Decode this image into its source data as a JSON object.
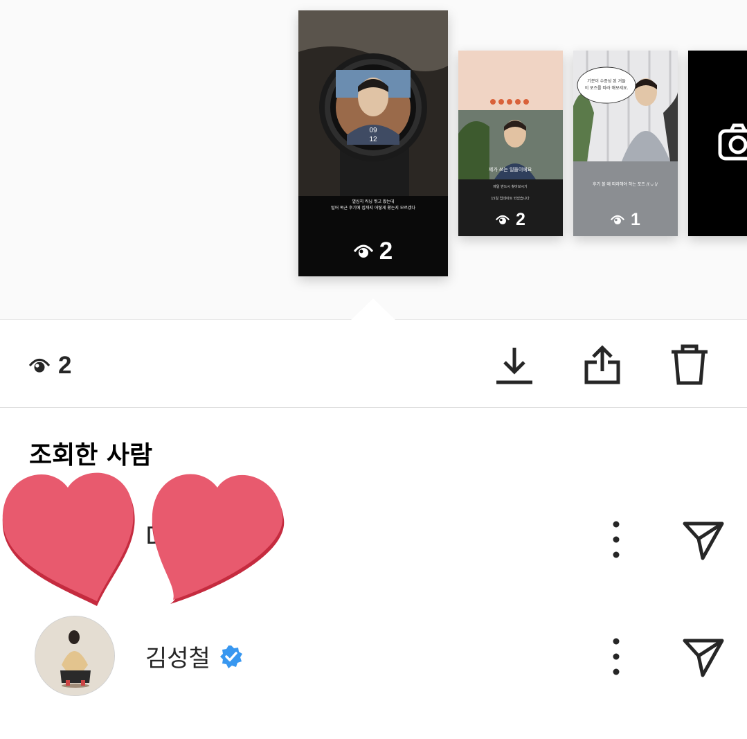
{
  "stories": [
    {
      "id": "story-1",
      "caption_line1": "열심히 러닝 뛰고 왔는데",
      "caption_line2": "털어 목근 후기에 집까지 어떻게 왔는지 모르겠다",
      "views": "2"
    },
    {
      "id": "story-2",
      "caption_line1": "제가 쓰는 일들이에요",
      "caption_line2": "15일 업데이트 되었습니다",
      "views": "2"
    },
    {
      "id": "story-3",
      "bubble": "기분이 수증성 된 거들 지면서 이 포즈를 따라 해보세요.",
      "caption": "후기 볼 때 따라해야 하는 포즈 /(·ᴗ·)/",
      "views": "1"
    }
  ],
  "selected_view_count": "2",
  "actions": {
    "download": "download",
    "share": "share",
    "delete": "delete"
  },
  "viewers_title": "조회한 사람",
  "viewers": [
    {
      "name": "D",
      "verified": false
    },
    {
      "name": "김성철",
      "verified": true
    }
  ],
  "icons": {
    "eye": "eye-icon",
    "download": "download-icon",
    "share": "share-icon",
    "trash": "trash-icon",
    "more": "more-vertical-icon",
    "send": "send-icon",
    "camera": "camera-icon",
    "verified": "verified-badge-icon"
  },
  "colors": {
    "verified_blue": "#3897f0",
    "heart_pink": "#e85a6e",
    "text_dark": "#262626"
  }
}
